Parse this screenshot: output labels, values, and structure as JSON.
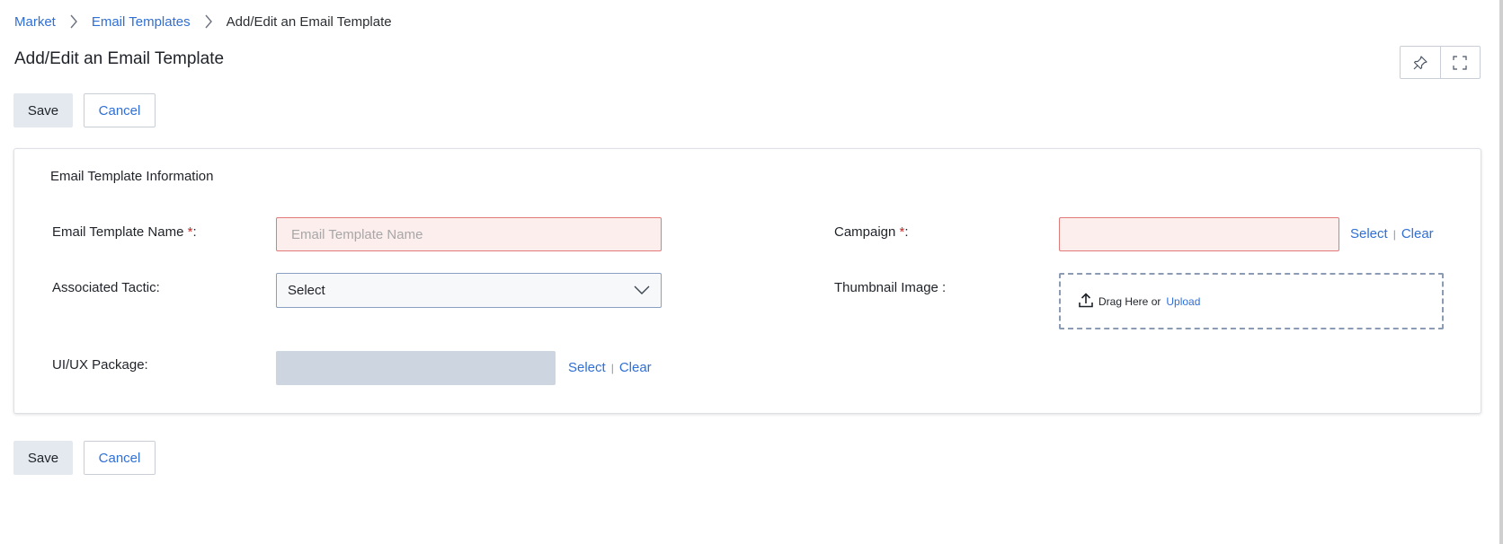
{
  "breadcrumb": {
    "items": [
      "Market",
      "Email Templates",
      "Add/Edit an Email Template"
    ]
  },
  "page": {
    "title": "Add/Edit an Email Template"
  },
  "toolbar": {
    "icons": [
      "pin-icon",
      "fullscreen-icon"
    ]
  },
  "actions": {
    "save_label": "Save",
    "cancel_label": "Cancel"
  },
  "form": {
    "section_title": "Email Template Information",
    "email_template_name": {
      "label": "Email Template Name ",
      "required_mark": "*",
      "suffix": ":",
      "placeholder": "Email Template Name",
      "value": ""
    },
    "campaign": {
      "label": "Campaign ",
      "required_mark": "*",
      "suffix": ":",
      "value": "",
      "select_label": "Select",
      "clear_label": "Clear"
    },
    "associated_tactic": {
      "label": "Associated Tactic:",
      "selected": "Select"
    },
    "thumbnail_image": {
      "label": "Thumbnail Image :",
      "drag_text": "Drag Here or",
      "upload_label": "Upload"
    },
    "uiux_package": {
      "label": "UI/UX Package:",
      "select_label": "Select",
      "clear_label": "Clear"
    }
  },
  "colors": {
    "link": "#2f6fd6",
    "error_bg": "#fdeeee",
    "error_border": "#e27a7a",
    "save_bg": "#e4e9f0",
    "disabled_bg": "#ccd5e0"
  }
}
